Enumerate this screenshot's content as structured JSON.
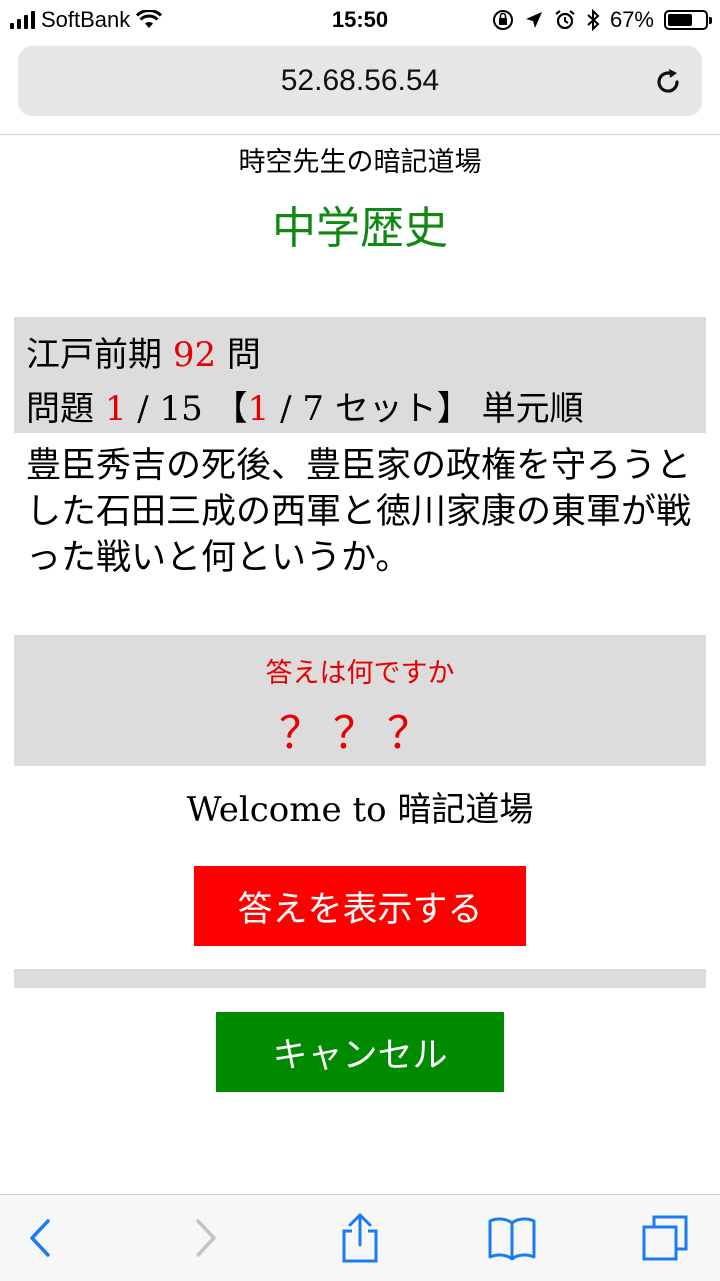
{
  "status_bar": {
    "carrier": "SoftBank",
    "time": "15:50",
    "battery": "67%",
    "battery_level": 0.67
  },
  "browser": {
    "url": "52.68.56.54"
  },
  "page": {
    "site_title": "時空先生の暗記道場",
    "subject": "中学歴史",
    "info": {
      "unit": "江戸前期",
      "total_count": "92",
      "count_suffix": "問",
      "question_label": "問題",
      "current": "1",
      "separator": "/",
      "total": "15",
      "set_open": "【",
      "set_current": "1",
      "set_total": "7",
      "set_label": "セット】",
      "order": "単元順"
    },
    "question": "豊臣秀吉の死後、豊臣家の政権を守ろうとした石田三成の西軍と徳川家康の東軍が戦った戦いと何というか。",
    "answer": {
      "label": "答えは何ですか",
      "hidden": "？？？"
    },
    "welcome": "Welcome to 暗記道場",
    "show_answer_button": "答えを表示する",
    "cancel_button": "キャンセル"
  },
  "colors": {
    "accent_red": "#e60000",
    "subject_green": "#118811",
    "button_red": "#ff0000",
    "button_green": "#008a00",
    "toolbar_blue": "#1a7cf5"
  }
}
